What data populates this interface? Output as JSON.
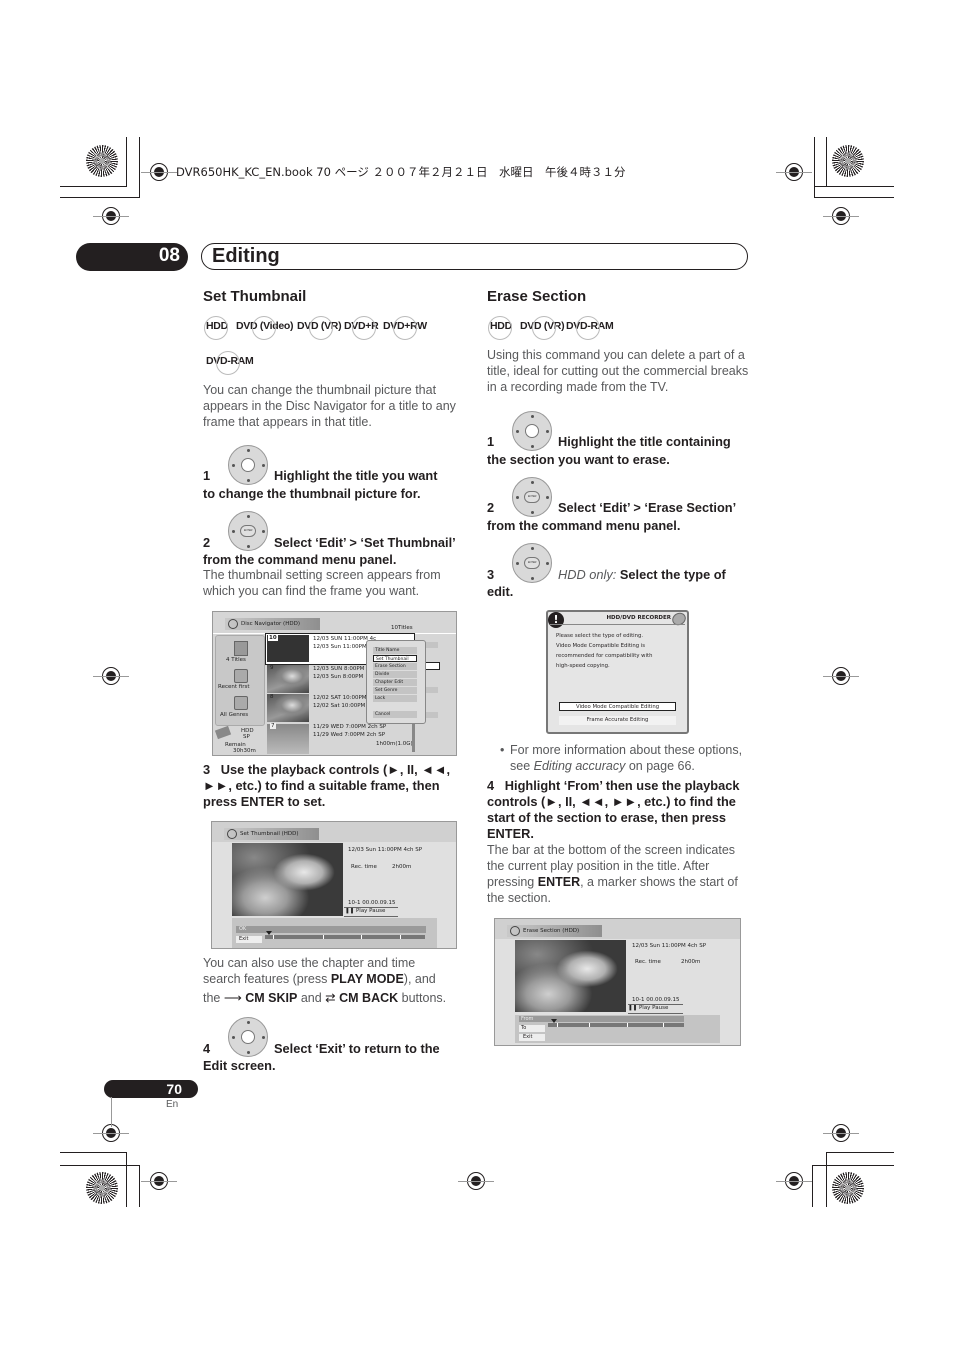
{
  "print_header": "DVR650HK_KC_EN.book  70 ページ  ２００７年２月２１日　水曜日　午後４時３１分",
  "chapter": {
    "number": "08",
    "title": "Editing"
  },
  "set_thumbnail": {
    "title": "Set Thumbnail",
    "discs": [
      "HDD",
      "DVD (Video)",
      "DVD (VR)",
      "DVD+R",
      "DVD+RW",
      "DVD-RAM"
    ],
    "intro": "You can change the thumbnail picture that appears in the Disc Navigator for a title to any frame that appears in that title.",
    "steps": [
      {
        "num": "1",
        "text_a": "Highlight the title you want",
        "text_b": "to change the thumbnail picture for.",
        "icon": "dpad-icon"
      },
      {
        "num": "2",
        "text_a": "Select ‘Edit’ > ‘Set Thumbnail’",
        "text_b": "from the command menu panel.",
        "note": "The thumbnail setting screen appears from which you can find the frame you want.",
        "icon": "dpad-enter-icon"
      },
      {
        "num": "3",
        "text": "Use the playback controls (►, II, ◄◄, ►►, etc.) to find a suitable frame, then press ENTER to set."
      },
      {
        "num": "4",
        "text_a": "Select ‘Exit’ to return to the",
        "text_b": "Edit screen.",
        "icon": "dpad-icon"
      }
    ],
    "also_text_1": "You can also use the chapter and time",
    "also_text_2a": "search features (press ",
    "also_text_2b": "PLAY MODE",
    "also_text_2c": "), and",
    "also_text_3a": "the ",
    "also_cm_skip": "CM SKIP",
    "also_and": " and ",
    "also_cm_back": "CM BACK",
    "also_buttons": " buttons."
  },
  "disc_navigator_screen": {
    "title": "Disc Navigator (HDD)",
    "count": "10Titles",
    "sidebar": [
      "4 Titles",
      "Recent first",
      "All Genres"
    ],
    "hdd": [
      "HDD",
      "SP",
      "Remain",
      "30h30m"
    ],
    "titles": [
      {
        "num": "10",
        "line1": "12/03 SUN  11:00PM 4c",
        "line2": "12/03 Sun  11:00PM"
      },
      {
        "num": "9",
        "line1": "12/03 SUN  8:00PM",
        "line2": "12/03  Sun  8:00PM"
      },
      {
        "num": "8",
        "line1": "12/02 SAT 10:00PM",
        "line2": "12/02 Sat  10:00PM"
      },
      {
        "num": "7",
        "line1": "11/29 WED 7:00PM 2ch  SP",
        "line2": "11/29 Wed  7:00PM 2ch  SP",
        "line3": "1h00m(1.0G)"
      }
    ],
    "menu": [
      "Title Name",
      "Set Thumbnail",
      "Erase Section",
      "Divide",
      "Chapter Edit",
      "Set Genre",
      "Lock",
      "Cancel"
    ]
  },
  "set_thumbnail_screen": {
    "title": "Set Thumbnail  (HDD)",
    "info": "12/03 Sun 11:00PM 4ch    SP",
    "rec_label": "Rec. time",
    "rec_value": "2h00m",
    "position": "10-1    00.00.09.15",
    "status": "Play Pause",
    "buttons": [
      "OK",
      "Exit"
    ]
  },
  "erase_section": {
    "title": "Erase Section",
    "discs": [
      "HDD",
      "DVD (VR)",
      "DVD-RAM"
    ],
    "intro": "Using this command you can delete a part of a title, ideal for cutting out the commercial breaks in a recording made from the TV.",
    "steps": [
      {
        "num": "1",
        "text_a": "Highlight the title containing",
        "text_b": "the section you want to erase.",
        "icon": "dpad-icon"
      },
      {
        "num": "2",
        "text_a": "Select ‘Edit’ > ‘Erase Section’",
        "text_b": "from the command menu panel.",
        "icon": "dpad-enter-icon"
      },
      {
        "num": "3",
        "text_italic": "HDD only:",
        "text_a": " Select the type of",
        "text_b": "edit.",
        "icon": "dpad-enter-icon"
      },
      {
        "num": "4",
        "text": "Highlight ‘From’ then use the playback controls (►, II, ◄◄, ►►, etc.) to find the start of the section to erase, then press ENTER."
      }
    ],
    "bullet_a": "For more information about these options, see ",
    "bullet_link": "Editing accuracy",
    "bullet_b": " on page 66.",
    "step4_note_a": "The bar at the bottom of the screen indicates the current play position in the title. After pressing ",
    "step4_note_bold": "ENTER",
    "step4_note_b": ", a marker shows the start of the section."
  },
  "recorder_dialog": {
    "title": "HDD/DVD RECORDER",
    "message": [
      "Please select the type of editing.",
      "Video Mode Compatible Editing is",
      "recommended for compatibility with",
      "high-speed copying."
    ],
    "options": [
      "Video Mode Compatible Editing",
      "Frame Accurate Editing"
    ]
  },
  "erase_section_screen": {
    "title": "Erase Section  (HDD)",
    "info": "12/03 Sun 11:00PM 4ch    SP",
    "rec_label": "Rec. time",
    "rec_value": "2h00m",
    "position": "10-1    00.00.09.15",
    "status": "Play Pause",
    "buttons": [
      "From",
      "To",
      "Exit"
    ]
  },
  "footer": {
    "page": "70",
    "lang": "En"
  }
}
